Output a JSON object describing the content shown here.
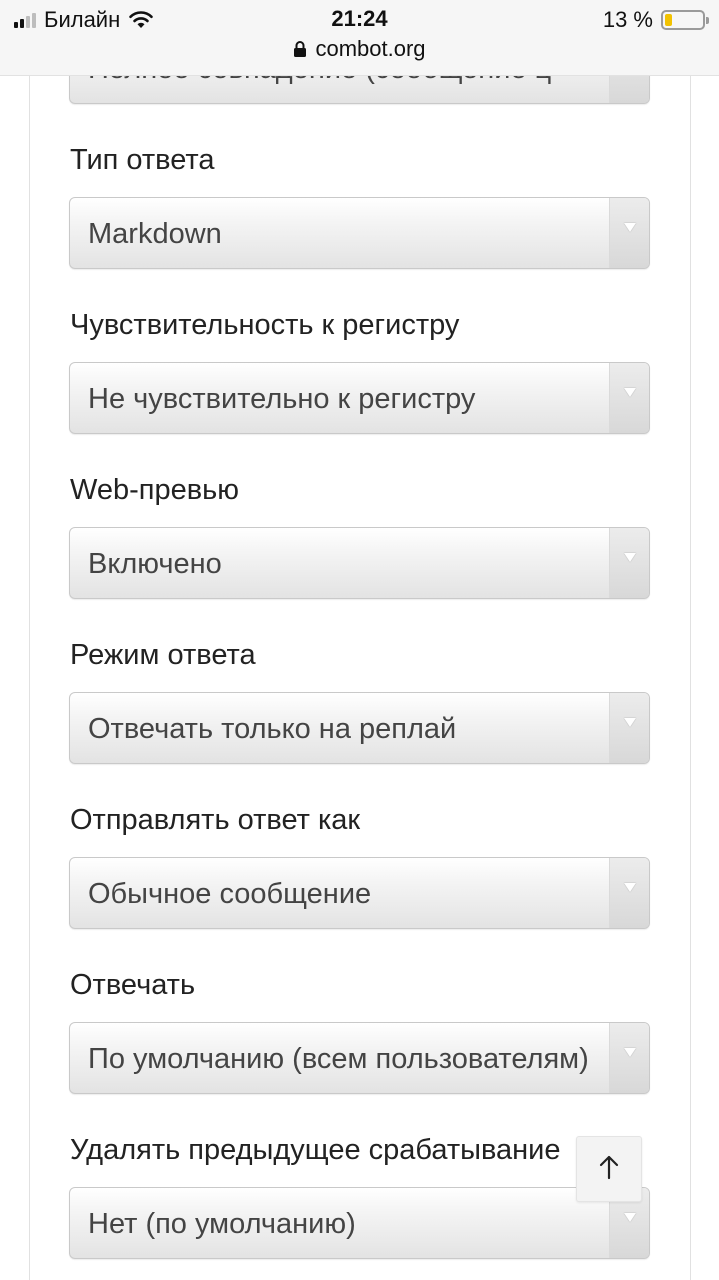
{
  "status_bar": {
    "carrier": "Билайн",
    "time": "21:24",
    "battery_percent": "13 %",
    "battery_level": 0.13,
    "url": "combot.org"
  },
  "form": {
    "top_partial_value": "Полное совпадение (сообщение ц",
    "fields": [
      {
        "label": "Тип ответа",
        "value": "Markdown"
      },
      {
        "label": "Чувствительность к регистру",
        "value": "Не чувствительно к регистру"
      },
      {
        "label": "Web-превью",
        "value": "Включено"
      },
      {
        "label": "Режим ответа",
        "value": "Отвечать только на реплай"
      },
      {
        "label": "Отправлять ответ как",
        "value": "Обычное сообщение"
      },
      {
        "label": "Отвечать",
        "value": "По умолчанию (всем пользователям)"
      },
      {
        "label": "Удалять предыдущее срабатывание",
        "value": "Нет (по умолчанию)"
      }
    ]
  },
  "icons": {
    "signal": "signal-bars-icon",
    "wifi": "wifi-icon",
    "battery": "battery-icon",
    "lock": "lock-icon",
    "dropdown": "dropdown-arrow-icon",
    "scroll_top": "arrow-up-icon"
  },
  "colors": {
    "battery_fill": "#f2c200"
  }
}
